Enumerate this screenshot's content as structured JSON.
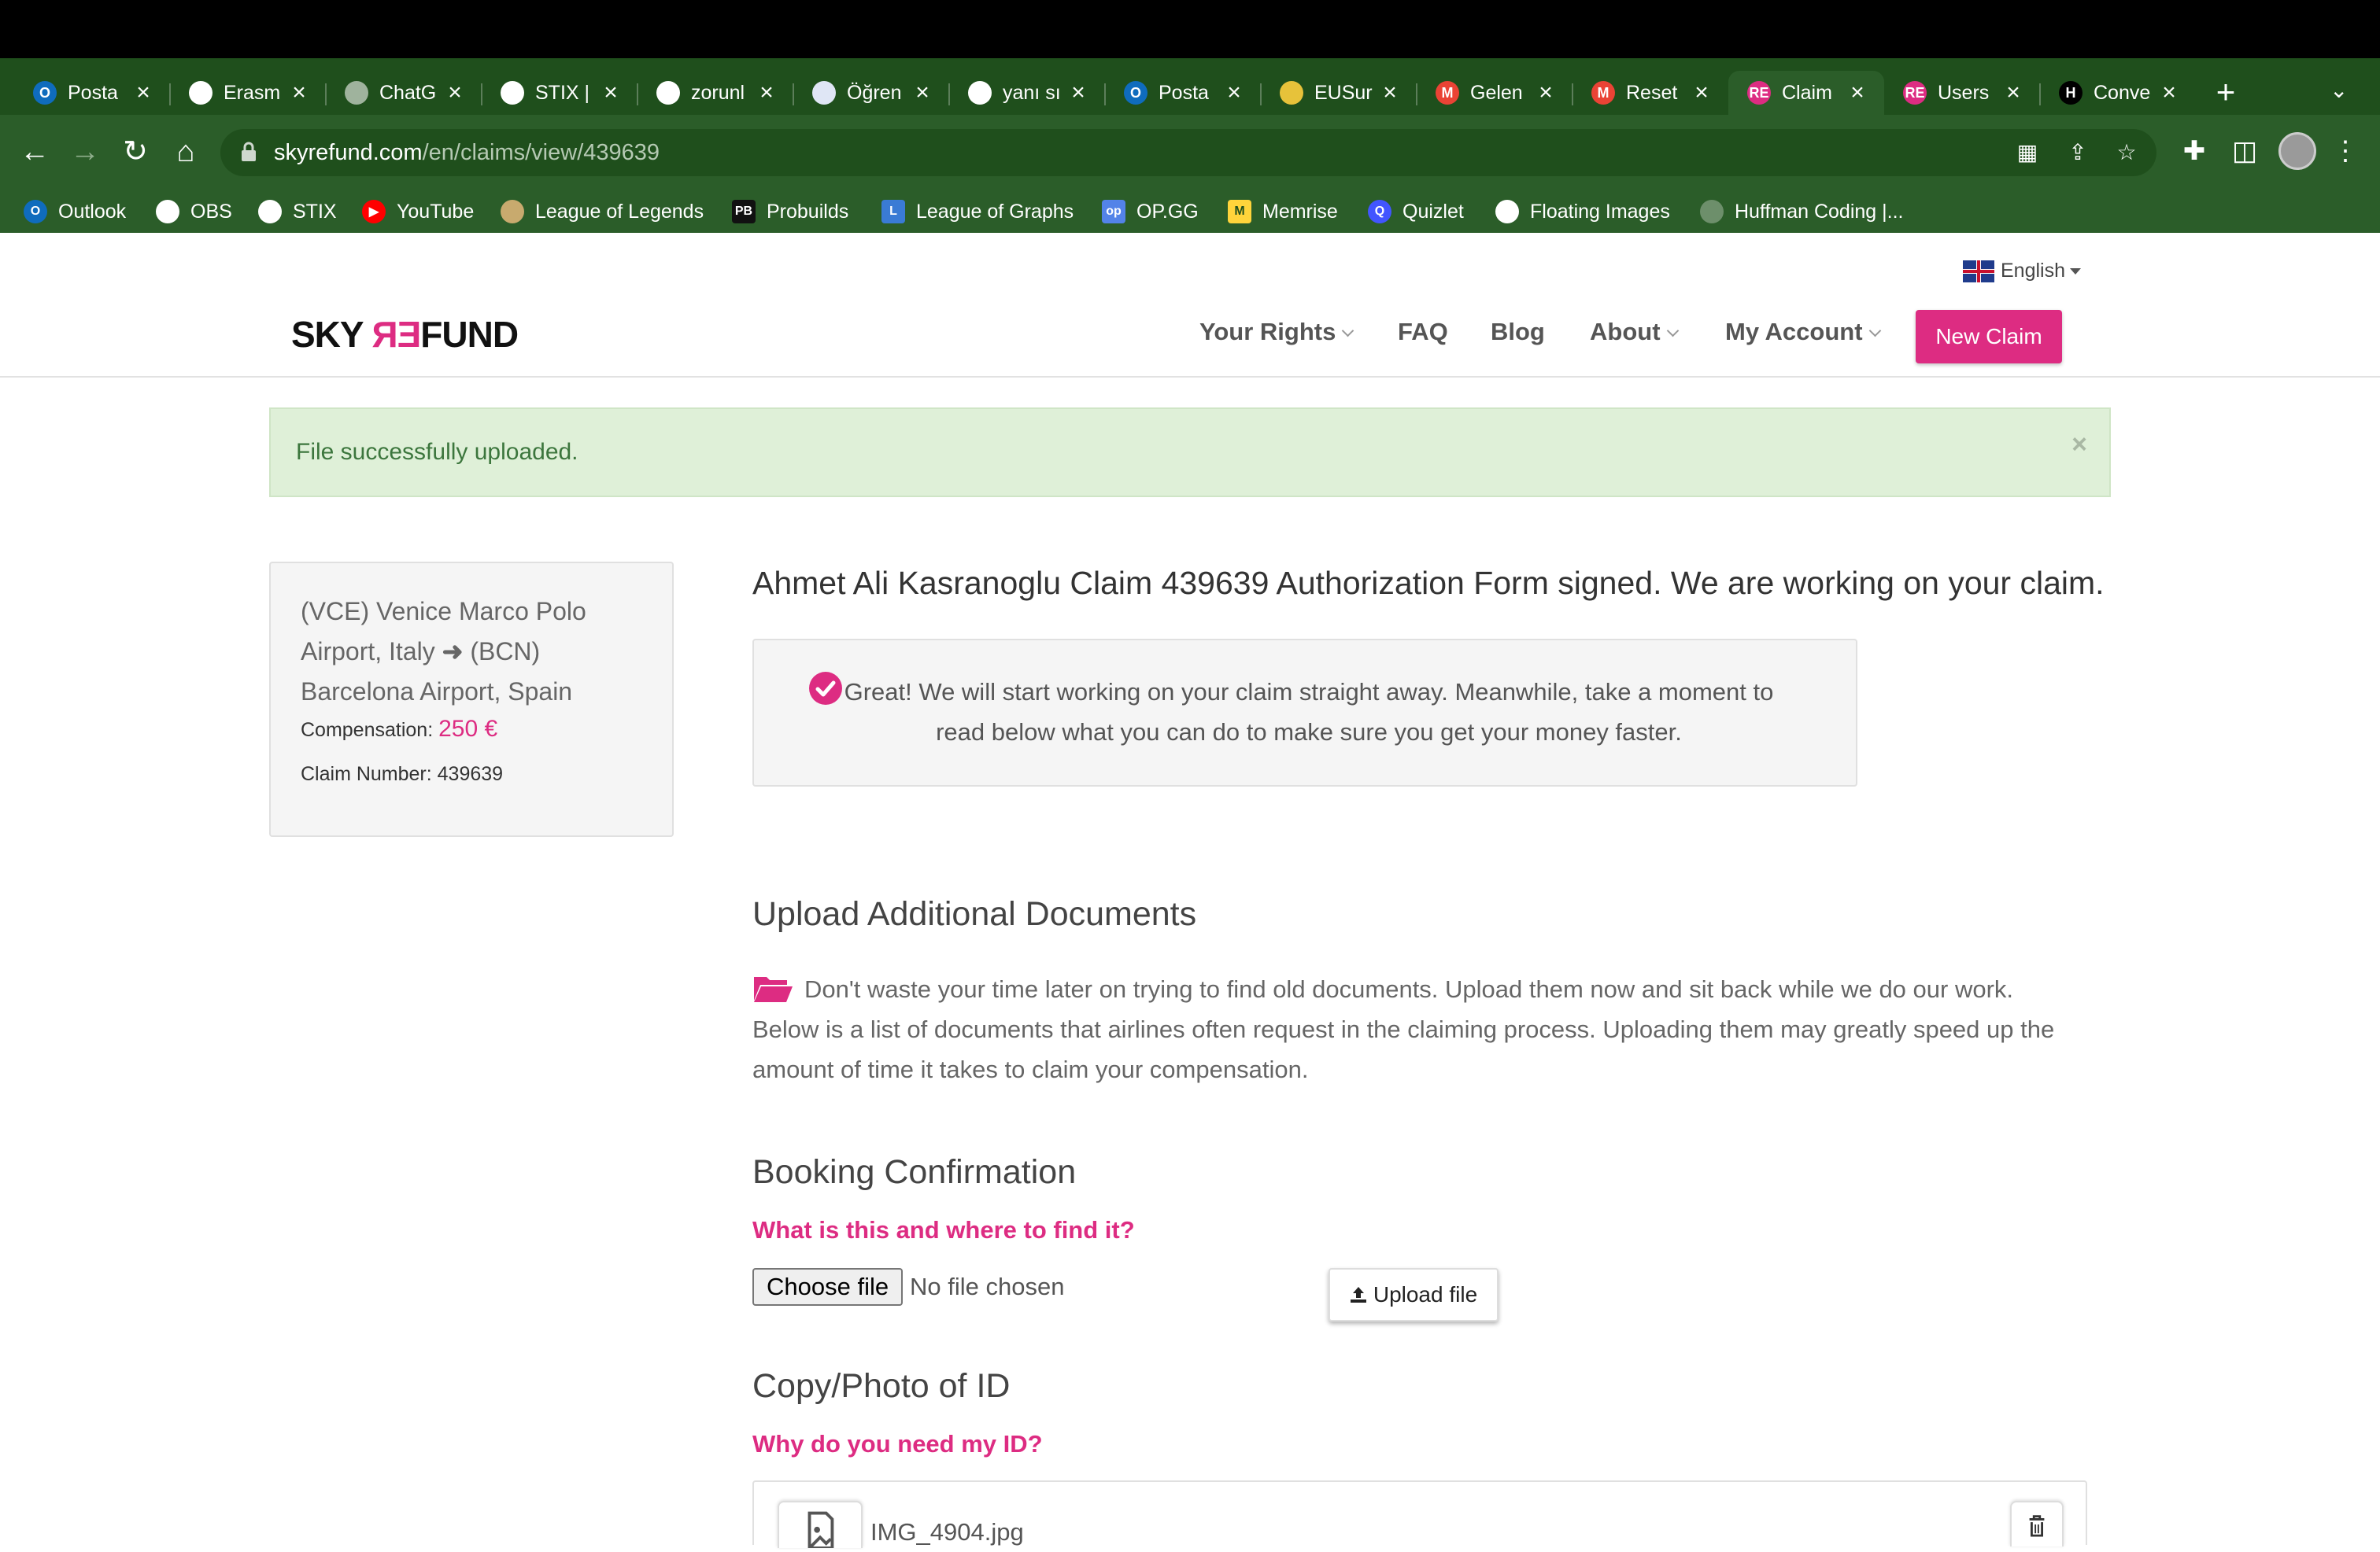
{
  "browser": {
    "tabs": [
      {
        "title": "Posta",
        "icon": "outlook-icon",
        "color": "#0f6cbd",
        "letter": "O"
      },
      {
        "title": "Erasm",
        "icon": "globe-icon",
        "color": "#ffffff",
        "letter": ""
      },
      {
        "title": "ChatG",
        "icon": "chatgpt-icon",
        "color": "#9fb39d",
        "letter": ""
      },
      {
        "title": "STIX |",
        "icon": "globe-icon",
        "color": "#ffffff",
        "letter": ""
      },
      {
        "title": "zorunl",
        "icon": "globe-icon",
        "color": "#ffffff",
        "letter": ""
      },
      {
        "title": "Öğren",
        "icon": "university-icon",
        "color": "#dfe6f5",
        "letter": ""
      },
      {
        "title": "yanı sı",
        "icon": "globe-icon",
        "color": "#ffffff",
        "letter": ""
      },
      {
        "title": "Posta",
        "icon": "outlook-icon",
        "color": "#0f6cbd",
        "letter": "O"
      },
      {
        "title": "EUSur",
        "icon": "eusurvey-icon",
        "color": "#e7c23a",
        "letter": ""
      },
      {
        "title": "Gelen",
        "icon": "gmail-icon",
        "color": "#ea4335",
        "letter": "M"
      },
      {
        "title": "Reset",
        "icon": "gmail-icon",
        "color": "#ea4335",
        "letter": "M"
      },
      {
        "title": "Claim",
        "icon": "skyrefund-icon",
        "color": "#dd2c82",
        "letter": "RE"
      },
      {
        "title": "Users",
        "icon": "skyrefund-icon",
        "color": "#dd2c82",
        "letter": "RE"
      },
      {
        "title": "Conve",
        "icon": "h-icon",
        "color": "#000000",
        "letter": "H"
      }
    ],
    "active_tab_index": 11,
    "url_host": "skyrefund.com",
    "url_path": "/en/claims/view/439639",
    "bookmarks": [
      {
        "label": "Outlook",
        "icon": "outlook-icon",
        "color": "#0f6cbd",
        "letter": "O"
      },
      {
        "label": "OBS",
        "icon": "globe-icon",
        "color": "#ffffff",
        "letter": ""
      },
      {
        "label": "STIX",
        "icon": "globe-icon",
        "color": "#ffffff",
        "letter": ""
      },
      {
        "label": "YouTube",
        "icon": "youtube-icon",
        "color": "#ff0000",
        "letter": "▶"
      },
      {
        "label": "League of Legends",
        "icon": "lol-icon",
        "color": "#c8aa6e",
        "letter": ""
      },
      {
        "label": "Probuilds",
        "icon": "probuilds-icon",
        "color": "#111111",
        "letter": "PB"
      },
      {
        "label": "League of Graphs",
        "icon": "leagueofgraphs-icon",
        "color": "#3a7bd5",
        "letter": "L"
      },
      {
        "label": "OP.GG",
        "icon": "opgg-icon",
        "color": "#5383e8",
        "letter": "op"
      },
      {
        "label": "Memrise",
        "icon": "memrise-icon",
        "color": "#ffd43b",
        "letter": "M"
      },
      {
        "label": "Quizlet",
        "icon": "quizlet-icon",
        "color": "#4255ff",
        "letter": "Q"
      },
      {
        "label": "Floating Images",
        "icon": "globe-icon",
        "color": "#ffffff",
        "letter": ""
      },
      {
        "label": "Huffman Coding |...",
        "icon": "huffman-icon",
        "color": "#6d8f6b",
        "letter": ""
      }
    ]
  },
  "site": {
    "language": "English",
    "logo": {
      "sky": "SKY ",
      "re": "ЯƎ",
      "fund": "FUND"
    },
    "nav": {
      "your_rights": "Your Rights",
      "faq": "FAQ",
      "blog": "Blog",
      "about": "About",
      "my_account": "My Account",
      "new_claim": "New Claim"
    },
    "accent_color": "#dd2c82"
  },
  "alert": {
    "message": "File successfully uploaded.",
    "close": "×"
  },
  "claim_summary": {
    "route_from": "(VCE) Venice Marco Polo Airport, Italy",
    "route_to": "(BCN) Barcelona Airport, Spain",
    "compensation_label": "Compensation:",
    "compensation_value": "250 €",
    "claim_number_label": "Claim Number:",
    "claim_number": "439639"
  },
  "main": {
    "heading": "Ahmet Ali Kasranoglu Claim 439639 Authorization Form signed. We are working on your claim.",
    "great_message": "Great! We will start working on your claim straight away. Meanwhile, take a moment to read below what you can do to make sure you get your money faster.",
    "upload_heading": "Upload Additional Documents",
    "upload_paragraph": "Don't waste your time later on trying to find old documents. Upload them now and sit back while we do our work. Below is a list of documents that airlines often request in the claiming process. Uploading them may greatly speed up the amount of time it takes to claim your compensation.",
    "booking": {
      "heading": "Booking Confirmation",
      "help_link": "What is this and where to find it?",
      "choose_file": "Choose file",
      "no_file": "No file chosen",
      "upload_button": "Upload file"
    },
    "id_doc": {
      "heading": "Copy/Photo of ID",
      "help_link": "Why do you need my ID?",
      "file_name": "IMG_4904.jpg"
    }
  }
}
